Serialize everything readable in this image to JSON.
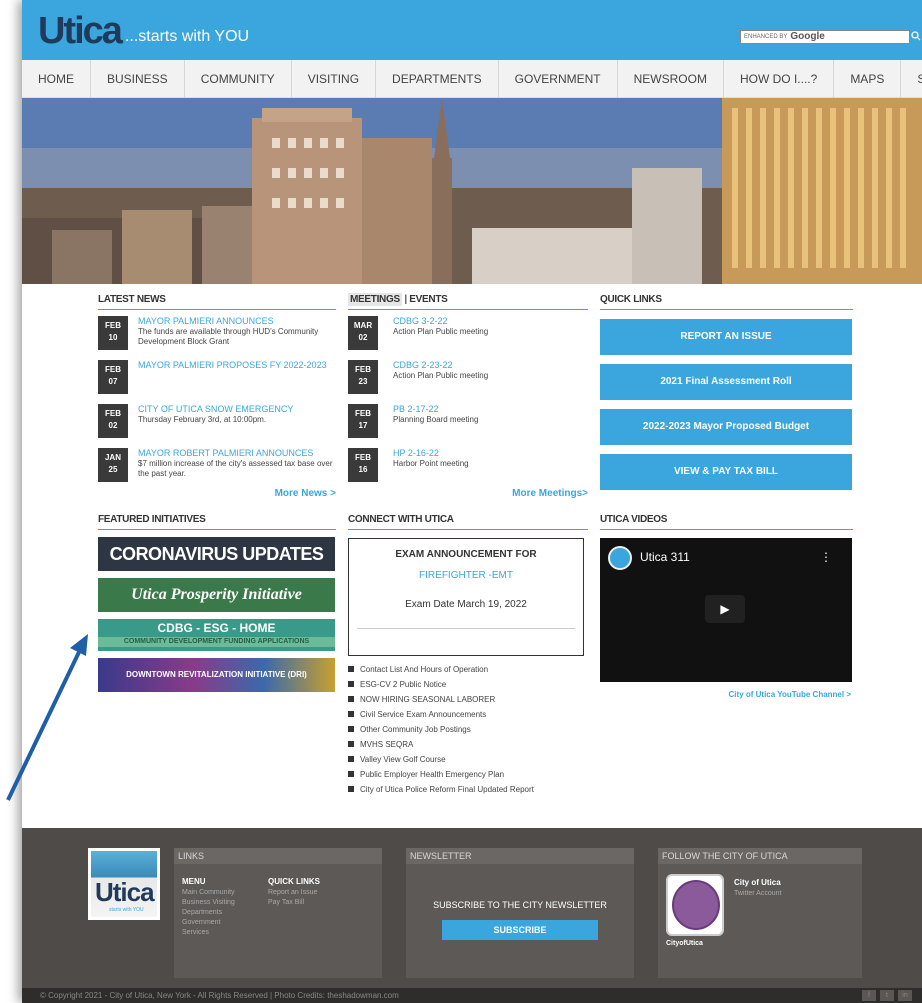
{
  "header": {
    "logo_main": "Utica",
    "logo_tagline": "...starts with YOU",
    "search_enhanced": "ENHANCED BY",
    "search_brand": "Google"
  },
  "nav": {
    "items": [
      "HOME",
      "BUSINESS",
      "COMMUNITY",
      "VISITING",
      "DEPARTMENTS",
      "GOVERNMENT",
      "NEWSROOM",
      "HOW DO I....?",
      "MAPS",
      "SITE MAP"
    ]
  },
  "latest_news": {
    "title": "LATEST NEWS",
    "items": [
      {
        "month": "FEB",
        "day": "10",
        "title": "MAYOR PALMIERI ANNOUNCES",
        "desc": "The funds are available through HUD's Community Development Block Grant"
      },
      {
        "month": "FEB",
        "day": "07",
        "title": "MAYOR PALMIERI PROPOSES FY 2022-2023",
        "desc": ""
      },
      {
        "month": "FEB",
        "day": "02",
        "title": "CITY OF UTICA SNOW EMERGENCY",
        "desc": "Thursday February 3rd, at 10:00pm."
      },
      {
        "month": "JAN",
        "day": "25",
        "title": "MAYOR ROBERT PALMIERI ANNOUNCES",
        "desc": "$7 million increase of the city's assessed tax base over the past year."
      }
    ],
    "more": "More News >"
  },
  "meetings": {
    "title_meetings": "MEETINGS",
    "title_sep": "|",
    "title_events": "EVENTS",
    "items": [
      {
        "month": "MAR",
        "day": "02",
        "title": "CDBG 3-2-22",
        "desc": "Action Plan Public meeting"
      },
      {
        "month": "FEB",
        "day": "23",
        "title": "CDBG 2-23-22",
        "desc": "Action Plan Public meeting"
      },
      {
        "month": "FEB",
        "day": "17",
        "title": "PB 2-17-22",
        "desc": "Planning Board meeting"
      },
      {
        "month": "FEB",
        "day": "16",
        "title": "HP 2-16-22",
        "desc": "Harbor Point meeting"
      }
    ],
    "more": "More Meetings>"
  },
  "quick_links": {
    "title": "QUICK LINKS",
    "buttons": [
      "REPORT AN ISSUE",
      "2021 Final Assessment Roll",
      "2022-2023 Mayor Proposed Budget",
      "VIEW & PAY TAX BILL"
    ]
  },
  "featured": {
    "title": "FEATURED INITIATIVES",
    "banners": {
      "corona": "CORONAVIRUS UPDATES",
      "prosperity": "Utica Prosperity Initiative",
      "cdbg_main": "CDBG - ESG - HOME",
      "cdbg_sub": "COMMUNITY DEVELOPMENT FUNDING APPLICATIONS",
      "dri": "DOWNTOWN REVITALIZATION INITIATIVE (DRI)"
    }
  },
  "connect": {
    "title": "CONNECT WITH UTICA",
    "box_title": "EXAM ANNOUNCEMENT FOR",
    "box_sub": "FIREFIGHTER -EMT",
    "box_date": "Exam Date March 19, 2022",
    "links": [
      "Contact List And Hours of Operation",
      "ESG-CV 2 Public Notice",
      "NOW HIRING SEASONAL LABORER",
      "Civil Service Exam Announcements",
      "Other Community Job Postings",
      "MVHS SEQRA",
      "Valley View Golf Course",
      "Public Employer Health Emergency Plan",
      "City of Utica Police Reform Final Updated Report"
    ]
  },
  "videos": {
    "title": "UTICA VIDEOS",
    "video_title": "Utica 311",
    "channel_link": "City of Utica YouTube Channel >"
  },
  "footer": {
    "logo_text": "Utica",
    "logo_sub": "starts with YOU",
    "links_title": "LINKS",
    "menu_head": "MENU",
    "menu_items": [
      "Main Community",
      "Business Visiting",
      "Departments",
      "Government",
      "Services"
    ],
    "quick_head": "QUICK LINKS",
    "quick_items": [
      "Report an Issue",
      "Pay Tax Bill"
    ],
    "newsletter_title": "NEWSLETTER",
    "newsletter_text": "SUBSCRIBE TO THE CITY NEWSLETTER",
    "subscribe": "SUBSCRIBE",
    "follow_title": "FOLLOW THE CITY OF UTICA",
    "follow_name": "City of Utica",
    "follow_sub": "Twitter Account",
    "handle": "CityofUtica",
    "copyright": "© Copyright 2021 - City of Utica, New York - All Rights Reserved | Photo Credits: theshadowman.com",
    "social": [
      "f",
      "t",
      "in"
    ]
  },
  "colors": {
    "accent": "#3aa6dd",
    "nav_bg": "#f2f2f2",
    "footer_bg": "#4e4b48",
    "arrow": "#1f5fa8"
  }
}
